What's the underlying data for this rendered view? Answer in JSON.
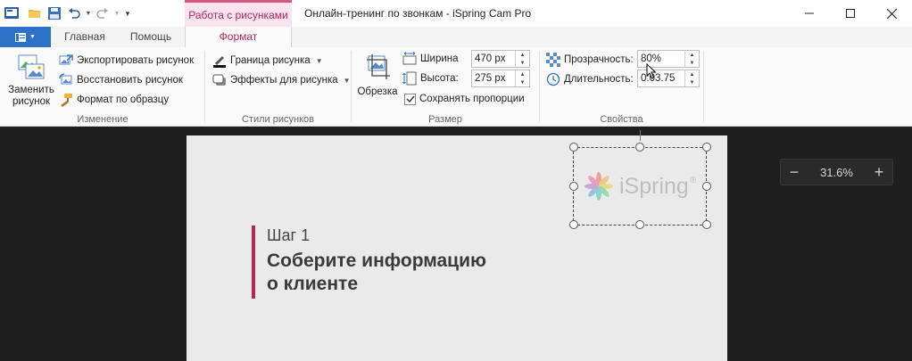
{
  "window": {
    "title": "Онлайн-тренинг по звонкам - iSpring Cam Pro",
    "context_tab_title": "Работа с рисунками"
  },
  "tabs": [
    {
      "label": "Главная"
    },
    {
      "label": "Помощь"
    },
    {
      "label": "Формат"
    }
  ],
  "ribbon": {
    "change": {
      "replace_label_1": "Заменить",
      "replace_label_2": "рисунок",
      "export_label": "Экспортировать рисунок",
      "restore_label": "Восстановить рисунок",
      "format_painter_label": "Формат по образцу",
      "group_label": "Изменение"
    },
    "styles": {
      "border_label": "Граница  рисунка",
      "effects_label": "Эффекты для рисунка",
      "group_label": "Стили рисунков"
    },
    "size": {
      "crop_label": "Обрезка",
      "width_label": "Ширина",
      "width_value": "470 px",
      "height_label": "Высота:",
      "height_value": "275 px",
      "keep_ratio_label": "Сохранять пропорции",
      "keep_ratio_checked": true,
      "group_label": "Размер"
    },
    "properties": {
      "transparency_label": "Прозрачность:",
      "transparency_value": "80%",
      "duration_label": "Длительность:",
      "duration_value": "0:03.75",
      "group_label": "Свойства"
    }
  },
  "slide": {
    "step": "Шаг 1",
    "heading_line1": "Соберите информацию",
    "heading_line2": "о клиенте",
    "logo_text": "iSpring",
    "logo_reg": "®"
  },
  "zoom": {
    "minus": "−",
    "value": "31.6%",
    "plus": "+"
  },
  "colors": {
    "accent": "#b4255a",
    "file_button": "#2b72c8",
    "stage_bg": "#1f1f1f"
  }
}
